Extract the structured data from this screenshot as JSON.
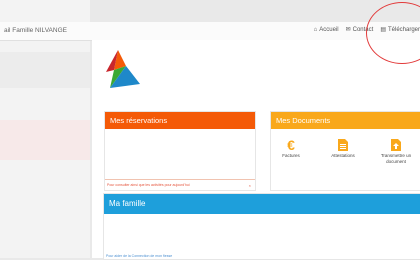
{
  "header": {
    "brand": "ail Famille NILVANGE",
    "nav": [
      {
        "icon": "home-icon",
        "glyph": "⌂",
        "label": "Accueil"
      },
      {
        "icon": "envelope-icon",
        "glyph": "✉",
        "label": "Contact"
      },
      {
        "icon": "document-icon",
        "glyph": "▤",
        "label": "Télécharger"
      }
    ]
  },
  "reservations": {
    "title": "Mes réservations",
    "footer_text": "Pour consulter ainsi que les activités pour aujourd'hui",
    "close": "×"
  },
  "documents": {
    "title": "Mes Documents",
    "items": [
      {
        "icon": "euro-icon",
        "label": "Factures"
      },
      {
        "icon": "file-icon",
        "label": "Attestations"
      },
      {
        "icon": "upload-file-icon",
        "label": "Transmettre un document"
      }
    ]
  },
  "famille": {
    "title": "Ma famille",
    "footer_text": "Pour aider de la Connection de mon fiesse"
  },
  "colors": {
    "reservations": "#f45a07",
    "documents": "#f9a81b",
    "famille": "#1e9fdb",
    "annotation": "#e23b3b"
  }
}
